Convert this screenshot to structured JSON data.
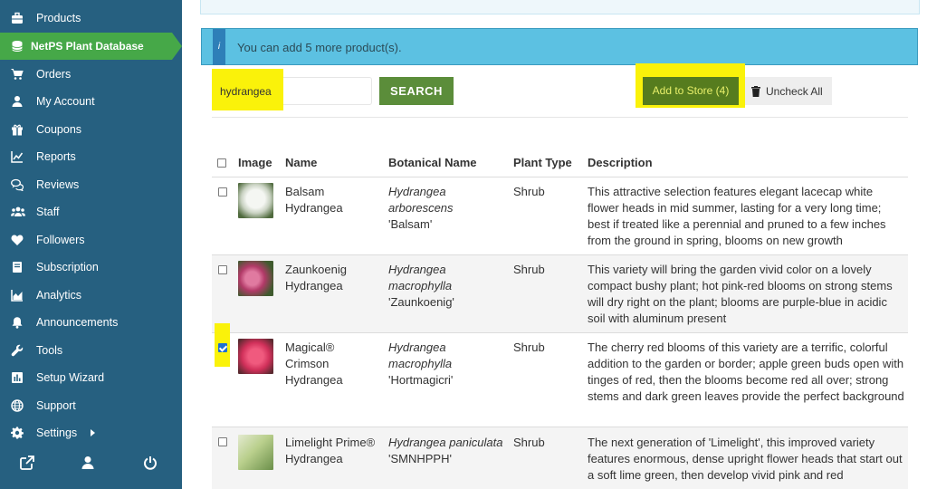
{
  "sidebar": {
    "items": [
      {
        "label": "Products",
        "icon": "briefcase-icon"
      },
      {
        "label": "NetPS Plant Database",
        "icon": "database-icon",
        "active": true
      },
      {
        "label": "Orders",
        "icon": "cart-icon"
      },
      {
        "label": "My Account",
        "icon": "user-icon"
      },
      {
        "label": "Coupons",
        "icon": "gift-icon"
      },
      {
        "label": "Reports",
        "icon": "line-chart-icon"
      },
      {
        "label": "Reviews",
        "icon": "comments-icon"
      },
      {
        "label": "Staff",
        "icon": "users-icon"
      },
      {
        "label": "Followers",
        "icon": "heart-icon"
      },
      {
        "label": "Subscription",
        "icon": "book-icon"
      },
      {
        "label": "Analytics",
        "icon": "area-chart-icon"
      },
      {
        "label": "Announcements",
        "icon": "bell-icon"
      },
      {
        "label": "Tools",
        "icon": "wrench-icon"
      },
      {
        "label": "Setup Wizard",
        "icon": "bar-chart-icon"
      },
      {
        "label": "Support",
        "icon": "globe-icon"
      },
      {
        "label": "Settings",
        "icon": "gear-icon"
      }
    ],
    "bottom_icons": [
      "external-link-icon",
      "user-icon",
      "power-icon"
    ]
  },
  "info": {
    "message": "You can add 5 more product(s).",
    "icon_glyph": "i"
  },
  "search": {
    "value": "hydrangea",
    "button_label": "SEARCH"
  },
  "actions": {
    "add_label": "Add to Store (4)",
    "uncheck_label": "Uncheck All"
  },
  "table": {
    "headers": [
      "Image",
      "Name",
      "Botanical Name",
      "Plant Type",
      "Description"
    ],
    "rows": [
      {
        "checked": false,
        "thumb_color": "#e9ece6",
        "name": "Balsam Hydrangea",
        "genus": "Hydrangea arborescens",
        "cultivar": "'Balsam'",
        "type": "Shrub",
        "description": "This attractive selection features elegant lacecap white flower heads in mid summer, lasting for a very long time; best if treated like a perennial and pruned to a few inches from the ground in spring, blooms on new growth"
      },
      {
        "checked": false,
        "thumb_color": "#c64b7a",
        "name": "Zaunkoenig Hydrangea",
        "genus": "Hydrangea macrophylla",
        "cultivar": "'Zaunkoenig'",
        "type": "Shrub",
        "description": "This variety will bring the garden vivid color on a lovely compact bushy plant; hot pink-red blooms on strong stems will dry right on the plant; blooms are purple-blue in acidic soil with aluminum present"
      },
      {
        "checked": true,
        "thumb_color": "#d8345a",
        "name": "Magical® Crimson Hydrangea",
        "genus": "Hydrangea macrophylla",
        "cultivar": "'Hortmagicri'",
        "type": "Shrub",
        "description": "The cherry red blooms of this variety are a terrific, colorful addition to the garden or border; apple green buds open with tinges of red, then the blooms become red all over; strong stems and dark green leaves provide the perfect background"
      },
      {
        "checked": false,
        "thumb_color": "#b9cf8c",
        "name": "Limelight Prime® Hydrangea",
        "genus": "Hydrangea paniculata",
        "cultivar": "'SMNHPPH'",
        "type": "Shrub",
        "description": "The next generation of 'Limelight', this improved variety features enormous, dense upright flower heads that start out a soft lime green, then develop vivid pink and red"
      }
    ]
  },
  "colors": {
    "sidebar_bg": "#266080",
    "active_item": "#46a848",
    "banner_bg": "#5cc1e2",
    "search_button": "#5b8d3a",
    "add_button": "#567c1e",
    "highlight": "#faf20a"
  }
}
